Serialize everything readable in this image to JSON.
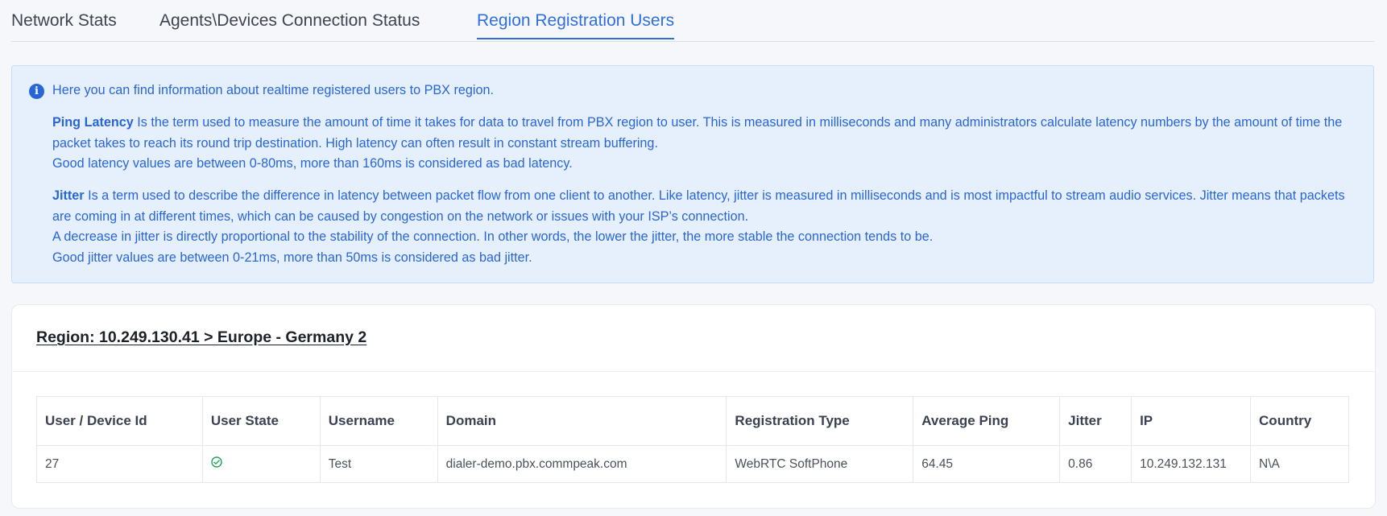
{
  "tabs": [
    {
      "label": "Network Stats",
      "active": false
    },
    {
      "label": "Agents\\Devices Connection Status",
      "active": false
    },
    {
      "label": "Region Registration Users",
      "active": true
    }
  ],
  "info": {
    "intro": "Here you can find information about realtime registered users to PBX region.",
    "ping": {
      "term": "Ping Latency",
      "text": " Is the term used to measure the amount of time it takes for data to travel from PBX region to user. This is measured in milliseconds and many administrators calculate latency numbers by the amount of time the packet takes to reach its round trip destination. High latency can often result in constant stream buffering.",
      "good": "Good latency values are between 0-80ms, more than 160ms is considered as bad latency."
    },
    "jitter": {
      "term": "Jitter",
      "text": " Is a term used to describe the difference in latency between packet flow from one client to another. Like latency, jitter is measured in milliseconds and is most impactful to stream audio services. Jitter means that packets are coming in at different times, which can be caused by congestion on the network or issues with your ISP’s connection.",
      "decrease": "A decrease in jitter is directly proportional to the stability of the connection. In other words, the lower the jitter, the more stable the connection tends to be.",
      "good": "Good jitter values are between 0-21ms, more than 50ms is considered as bad jitter."
    }
  },
  "region": {
    "title": "Region: 10.249.130.41 > Europe - Germany 2"
  },
  "table": {
    "headers": [
      "User / Device Id",
      "User State",
      "Username",
      "Domain",
      "Registration Type",
      "Average Ping",
      "Jitter",
      "IP",
      "Country"
    ],
    "rows": [
      {
        "user_device_id": "27",
        "user_state_icon": "check-circle-icon",
        "username": "Test",
        "domain": "dialer-demo.pbx.commpeak.com",
        "registration_type": "WebRTC SoftPhone",
        "average_ping": "64.45",
        "jitter": "0.86",
        "ip": "10.249.132.131",
        "country": "N\\A"
      }
    ]
  },
  "colors": {
    "accent": "#2f6fe0",
    "info_bg": "#e6effc",
    "success": "#22a45d"
  }
}
